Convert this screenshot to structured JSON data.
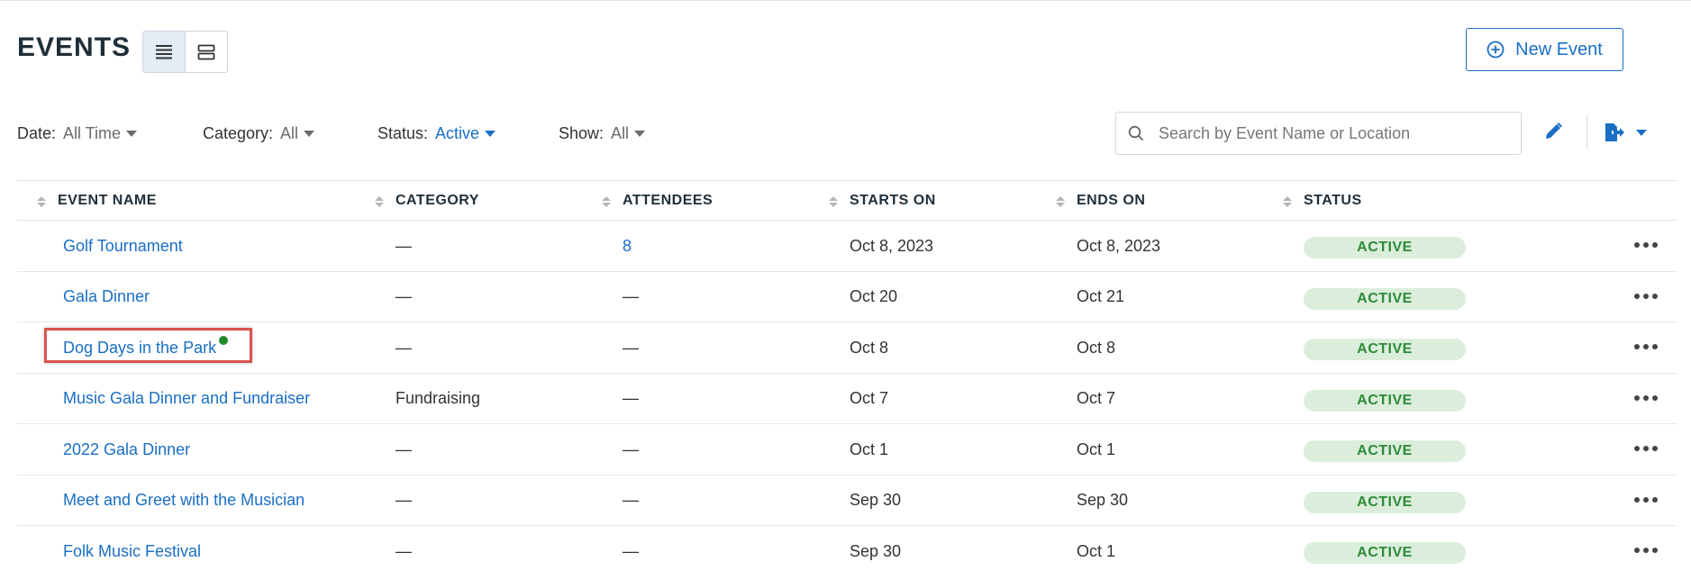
{
  "header": {
    "title": "EVENTS",
    "new_event_label": "New Event"
  },
  "filters": [
    {
      "label": "Date:",
      "value": "All Time",
      "highlighted": false
    },
    {
      "label": "Category:",
      "value": "All",
      "highlighted": false
    },
    {
      "label": "Status:",
      "value": "Active",
      "highlighted": true
    },
    {
      "label": "Show:",
      "value": "All",
      "highlighted": false
    }
  ],
  "search": {
    "placeholder": "Search by Event Name or Location",
    "value": ""
  },
  "table": {
    "columns": [
      "EVENT NAME",
      "CATEGORY",
      "ATTENDEES",
      "STARTS ON",
      "ENDS ON",
      "STATUS"
    ],
    "rows": [
      {
        "name": "Golf Tournament",
        "category": "—",
        "attendees": "8",
        "starts": "Oct 8, 2023",
        "ends": "Oct 8, 2023",
        "status": "ACTIVE"
      },
      {
        "name": "Gala Dinner",
        "category": "—",
        "attendees": "—",
        "starts": "Oct 20",
        "ends": "Oct 21",
        "status": "ACTIVE"
      },
      {
        "name": "Dog Days in the Park",
        "category": "—",
        "attendees": "—",
        "starts": "Oct 8",
        "ends": "Oct 8",
        "status": "ACTIVE"
      },
      {
        "name": "Music Gala Dinner and Fundraiser",
        "category": "Fundraising",
        "attendees": "—",
        "starts": "Oct 7",
        "ends": "Oct 7",
        "status": "ACTIVE"
      },
      {
        "name": "2022 Gala Dinner",
        "category": "—",
        "attendees": "—",
        "starts": "Oct 1",
        "ends": "Oct 1",
        "status": "ACTIVE"
      },
      {
        "name": "Meet and Greet with the Musician",
        "category": "—",
        "attendees": "—",
        "starts": "Sep 30",
        "ends": "Sep 30",
        "status": "ACTIVE"
      },
      {
        "name": "Folk Music Festival",
        "category": "—",
        "attendees": "—",
        "starts": "Sep 30",
        "ends": "Oct 1",
        "status": "ACTIVE"
      }
    ]
  },
  "icons": {
    "list_view": "list-view-icon",
    "card_view": "card-view-icon",
    "new_event": "plus-circle-icon",
    "search": "search-icon",
    "edit": "pencil-icon",
    "export": "export-icon",
    "more": "more-horizontal-icon"
  },
  "colors": {
    "accent": "#1a6fc4",
    "status_active_bg": "#dbeedb",
    "status_active_text": "#2e8b3a",
    "highlight_border": "#d9534f",
    "indicator_dot": "#1e8a2a"
  }
}
